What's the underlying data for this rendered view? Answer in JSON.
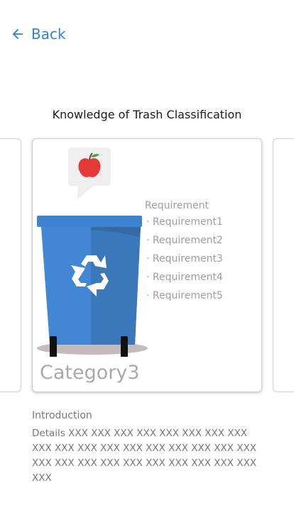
{
  "header": {
    "back_label": "Back"
  },
  "page": {
    "title": "Knowledge of Trash Classification"
  },
  "card": {
    "category": "Category3",
    "requirement_title": "Requirement",
    "requirements": [
      "· Requirement1",
      "· Requirement2",
      "· Requirement3",
      "· Requirement4",
      "· Requirement5"
    ],
    "bin_color": "#3d7fc4"
  },
  "intro": {
    "title": "Introduction",
    "details": "Details XXX XXX XXX XXX XXX XXX XXX XXX XXX XXX XXX XXX XXX XXX XXX XXX XXX XXX XXX XXX XXX XXX XXX XXX XXX XXX XXX XXX XXX"
  },
  "colors": {
    "accent": "#2f80e4"
  }
}
